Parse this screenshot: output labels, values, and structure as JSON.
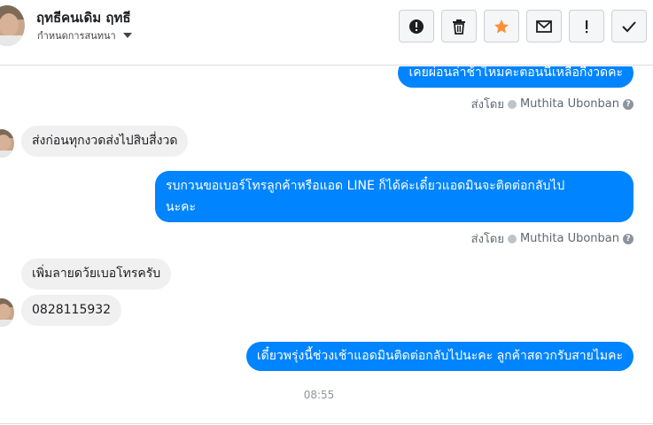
{
  "header": {
    "contact_name": "ฤทธีคนเดิม ฤทธี",
    "assign_label": "กำหนดการสนทนา",
    "toolbar": [
      {
        "name": "report-spam-button",
        "icon": "exclamation-circle-icon"
      },
      {
        "name": "delete-button",
        "icon": "trash-icon"
      },
      {
        "name": "star-button",
        "icon": "star-icon",
        "color": "#f7923b"
      },
      {
        "name": "mark-unread-button",
        "icon": "envelope-icon"
      },
      {
        "name": "flag-button",
        "icon": "exclamation-icon"
      },
      {
        "name": "mark-done-button",
        "icon": "check-icon"
      }
    ]
  },
  "thread": {
    "messages": [
      {
        "dir": "out",
        "text": "เคยผ่อนล่าช้าไหมคะตอนนี้เหลือกี่งวดคะ"
      },
      {
        "dir": "meta",
        "sent_by_label": "ส่งโดย",
        "sender": "Muthita Ubonban"
      },
      {
        "dir": "in",
        "text": "ส่งก่อนทุกงวดส่งไปสิบสี่งวด"
      },
      {
        "dir": "out",
        "text": "รบกวนขอเบอร์โทรลูกค้าหรือแอด LINE ก็ได้ค่ะเดี๋ยวแอดมินจะติดต่อกลับไป",
        "text2": "นะคะ"
      },
      {
        "dir": "meta",
        "sent_by_label": "ส่งโดย",
        "sender": "Muthita Ubonban"
      },
      {
        "dir": "in",
        "text": "เพิ่มลายดว้ยเบอโทรครับ"
      },
      {
        "dir": "in",
        "text": "0828115932"
      },
      {
        "dir": "out",
        "text": "เดี๋ยวพรุ่งนี้ช่วงเช้าแอดมินติดต่อกลับไปนะคะ ลูกค้าสดวกรับสายไมคะ"
      }
    ],
    "timestamp": "08:55"
  },
  "colors": {
    "outgoing_bubble": "#0084ff",
    "incoming_bubble": "#f1f0f0",
    "star": "#f7923b"
  }
}
